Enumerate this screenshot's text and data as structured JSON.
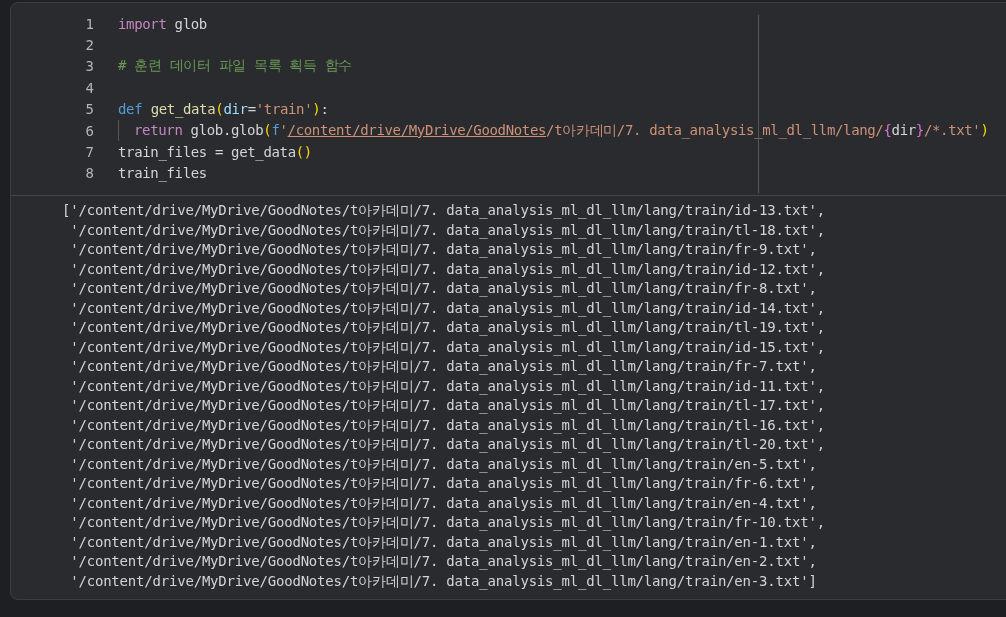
{
  "cell": {
    "code": [
      {
        "number": "1",
        "tokens": [
          {
            "kind": "keyword",
            "text": "import"
          },
          {
            "kind": "plain",
            "text": " glob"
          }
        ]
      },
      {
        "number": "2"
      },
      {
        "number": "3",
        "tokens": [
          {
            "kind": "comment",
            "text": "# 훈련 데이터 파일 목록 획득 함수"
          }
        ]
      },
      {
        "number": "4"
      },
      {
        "number": "5",
        "tokens": [
          {
            "kind": "storage",
            "text": "def"
          },
          {
            "kind": "function",
            "text": "get_data",
            "spaced": true
          },
          {
            "kind": "bracket",
            "text": "("
          },
          {
            "kind": "param",
            "text": "dir"
          },
          {
            "kind": "plain",
            "text": "="
          },
          {
            "kind": "string",
            "text": "'train'"
          },
          {
            "kind": "bracket",
            "text": ")"
          },
          {
            "kind": "plain",
            "text": ":"
          }
        ]
      },
      {
        "number": "6",
        "indented": true,
        "tokens": [
          {
            "kind": "keyword",
            "text": "return"
          },
          {
            "kind": "plain",
            "text": " glob.glob"
          },
          {
            "kind": "bracket",
            "text": "("
          },
          {
            "kind": "storage",
            "text": "f"
          },
          {
            "kind": "string",
            "text": "'"
          },
          {
            "kind": "link",
            "text": "/content/drive/MyDrive/GoodNotes"
          },
          {
            "kind": "string",
            "text": "/t아카데미/7. data_analysis_ml_dl_llm/lang/"
          },
          {
            "kind": "brace",
            "text": "{"
          },
          {
            "kind": "plain",
            "text": "dir"
          },
          {
            "kind": "brace",
            "text": "}"
          },
          {
            "kind": "string",
            "text": "/*.txt'"
          },
          {
            "kind": "bracket",
            "text": ")"
          }
        ]
      },
      {
        "number": "7",
        "tokens": [
          {
            "kind": "plain",
            "text": "train_files = get_data"
          },
          {
            "kind": "bracket",
            "text": "()"
          }
        ]
      },
      {
        "number": "8",
        "tokens": [
          {
            "kind": "plain",
            "text": "train_files"
          }
        ]
      }
    ],
    "output": [
      "['/content/drive/MyDrive/GoodNotes/t아카데미/7. data_analysis_ml_dl_llm/lang/train/id-13.txt',",
      " '/content/drive/MyDrive/GoodNotes/t아카데미/7. data_analysis_ml_dl_llm/lang/train/tl-18.txt',",
      " '/content/drive/MyDrive/GoodNotes/t아카데미/7. data_analysis_ml_dl_llm/lang/train/fr-9.txt',",
      " '/content/drive/MyDrive/GoodNotes/t아카데미/7. data_analysis_ml_dl_llm/lang/train/id-12.txt',",
      " '/content/drive/MyDrive/GoodNotes/t아카데미/7. data_analysis_ml_dl_llm/lang/train/fr-8.txt',",
      " '/content/drive/MyDrive/GoodNotes/t아카데미/7. data_analysis_ml_dl_llm/lang/train/id-14.txt',",
      " '/content/drive/MyDrive/GoodNotes/t아카데미/7. data_analysis_ml_dl_llm/lang/train/tl-19.txt',",
      " '/content/drive/MyDrive/GoodNotes/t아카데미/7. data_analysis_ml_dl_llm/lang/train/id-15.txt',",
      " '/content/drive/MyDrive/GoodNotes/t아카데미/7. data_analysis_ml_dl_llm/lang/train/fr-7.txt',",
      " '/content/drive/MyDrive/GoodNotes/t아카데미/7. data_analysis_ml_dl_llm/lang/train/id-11.txt',",
      " '/content/drive/MyDrive/GoodNotes/t아카데미/7. data_analysis_ml_dl_llm/lang/train/tl-17.txt',",
      " '/content/drive/MyDrive/GoodNotes/t아카데미/7. data_analysis_ml_dl_llm/lang/train/tl-16.txt',",
      " '/content/drive/MyDrive/GoodNotes/t아카데미/7. data_analysis_ml_dl_llm/lang/train/tl-20.txt',",
      " '/content/drive/MyDrive/GoodNotes/t아카데미/7. data_analysis_ml_dl_llm/lang/train/en-5.txt',",
      " '/content/drive/MyDrive/GoodNotes/t아카데미/7. data_analysis_ml_dl_llm/lang/train/fr-6.txt',",
      " '/content/drive/MyDrive/GoodNotes/t아카데미/7. data_analysis_ml_dl_llm/lang/train/en-4.txt',",
      " '/content/drive/MyDrive/GoodNotes/t아카데미/7. data_analysis_ml_dl_llm/lang/train/fr-10.txt',",
      " '/content/drive/MyDrive/GoodNotes/t아카데미/7. data_analysis_ml_dl_llm/lang/train/en-1.txt',",
      " '/content/drive/MyDrive/GoodNotes/t아카데미/7. data_analysis_ml_dl_llm/lang/train/en-2.txt',",
      " '/content/drive/MyDrive/GoodNotes/t아카데미/7. data_analysis_ml_dl_llm/lang/train/en-3.txt']"
    ]
  }
}
